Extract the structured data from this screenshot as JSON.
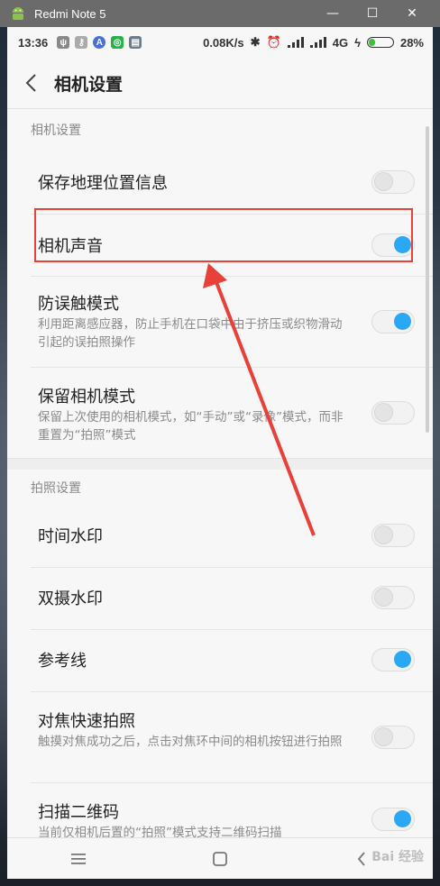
{
  "window": {
    "title": "Redmi Note 5",
    "minimize": "—",
    "maximize": "☐",
    "close": "✕"
  },
  "status_bar": {
    "time": "13:36",
    "network_speed": "0.08K/s",
    "network_type": "4G",
    "battery": "28%",
    "battery_level": 0.28
  },
  "header": {
    "title": "相机设置"
  },
  "sections": [
    {
      "label": "相机设置",
      "items": [
        {
          "label": "保存地理位置信息",
          "desc": "",
          "on": false
        },
        {
          "label": "相机声音",
          "desc": "",
          "on": true
        },
        {
          "label": "防误触模式",
          "desc": "利用距离感应器，防止手机在口袋中由于挤压或织物滑动引起的误拍照操作",
          "on": true
        },
        {
          "label": "保留相机模式",
          "desc": "保留上次使用的相机模式，如“手动”或“录像”模式，而非重置为“拍照”模式",
          "on": false
        }
      ]
    },
    {
      "label": "拍照设置",
      "items": [
        {
          "label": "时间水印",
          "desc": "",
          "on": false
        },
        {
          "label": "双摄水印",
          "desc": "",
          "on": false
        },
        {
          "label": "参考线",
          "desc": "",
          "on": true
        },
        {
          "label": "对焦快速拍照",
          "desc": "触摸对焦成功之后，点击对焦环中间的相机按钮进行拍照",
          "on": false
        },
        {
          "label": "扫描二维码",
          "desc": "当前仅相机后置的“拍照”模式支持二维码扫描",
          "on": true
        }
      ]
    }
  ],
  "watermark": "Bai 经验",
  "colors": {
    "toggle_on": "#2aa7f5",
    "highlight": "#e8413a",
    "arrow": "#e8413a"
  }
}
